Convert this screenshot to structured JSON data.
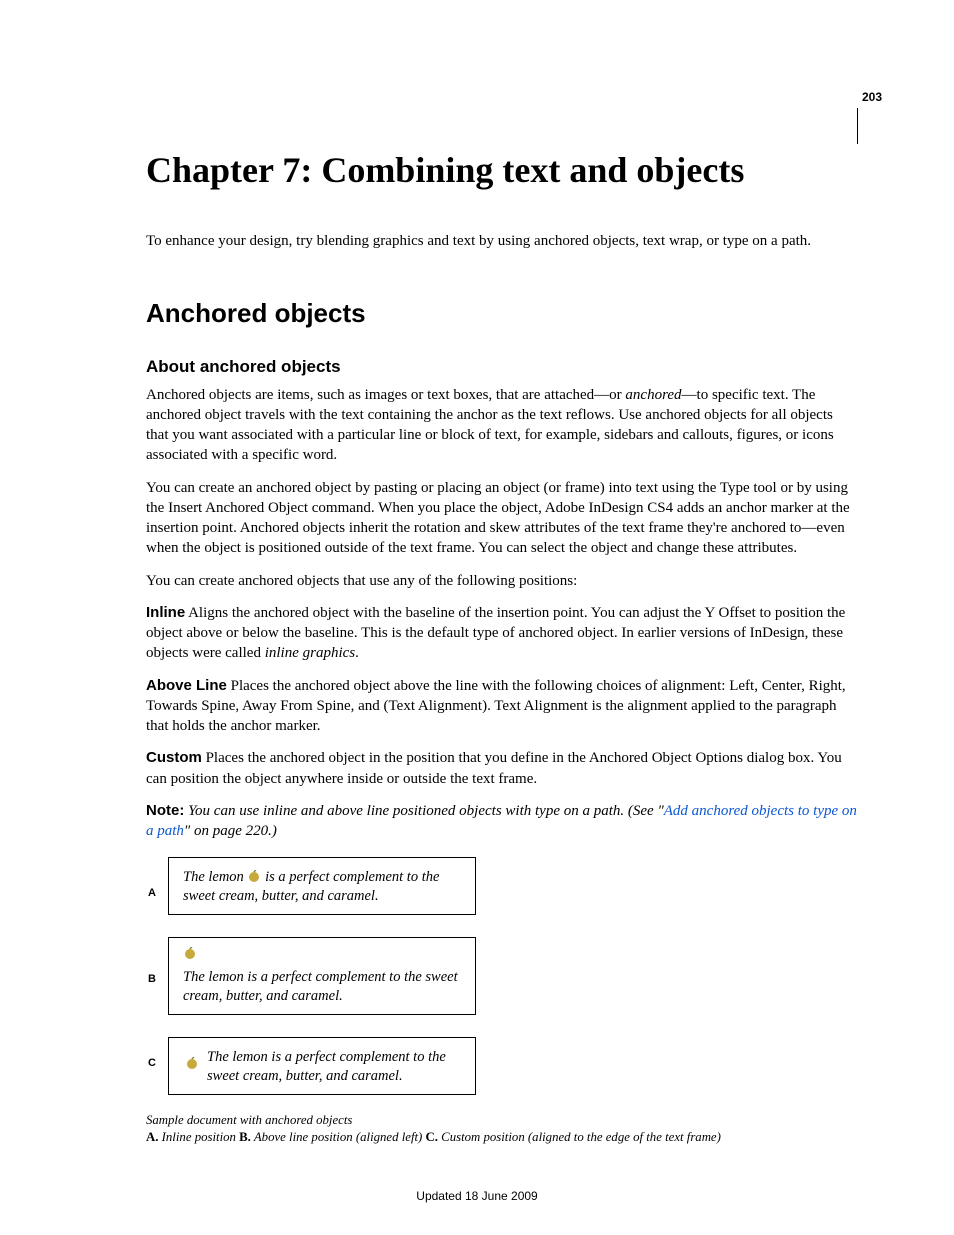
{
  "page_number": "203",
  "chapter_title": "Chapter 7: Combining text and objects",
  "intro": "To enhance your design, try blending graphics and text by using anchored objects, text wrap, or type on a path.",
  "section_title": "Anchored objects",
  "subsection_title": "About anchored objects",
  "para1_a": "Anchored objects are items, such as images or text boxes, that are attached—or ",
  "para1_em": "anchored",
  "para1_b": "—to specific text. The anchored object travels with the text containing the anchor as the text reflows. Use anchored objects for all objects that you want associated with a particular line or block of text, for example, sidebars and callouts, figures, or icons associated with a specific word.",
  "para2": "You can create an anchored object by pasting or placing an object (or frame) into text using the Type tool or by using the Insert Anchored Object command. When you place the object, Adobe InDesign CS4 adds an anchor marker at the insertion point. Anchored objects inherit the rotation and skew attributes of the text frame they're anchored to—even when the object is positioned outside of the text frame. You can select the object and change these attributes.",
  "para3": "You can create anchored objects that use any of the following positions:",
  "inline_label": "Inline",
  "inline_text_a": "  Aligns the anchored object with the baseline of the insertion point. You can adjust the Y Offset to position the object above or below the baseline. This is the default type of anchored object. In earlier versions of InDesign, these objects were called ",
  "inline_em": "inline graphics",
  "inline_text_b": ".",
  "above_label": "Above Line",
  "above_text": "  Places the anchored object above the line with the following choices of alignment: Left, Center, Right, Towards Spine, Away From Spine, and (Text Alignment). Text Alignment is the alignment applied to the paragraph that holds the anchor marker.",
  "custom_label": "Custom",
  "custom_text": "  Places the anchored object in the position that you define in the Anchored Object Options dialog box. You can position the object anywhere inside or outside the text frame.",
  "note_label": "Note:",
  "note_a": " You can use inline and above line positioned objects with type on a path. (See \"",
  "note_link": "Add anchored objects to type on a path",
  "note_b": "\" on page 220.)",
  "fig": {
    "label_a": "A",
    "label_b": "B",
    "label_c": "C",
    "text_a1": "The lemon ",
    "text_a2": " is a perfect complement to the sweet cream, butter, and caramel.",
    "text_b": "The lemon is a perfect complement to the sweet cream, butter, and caramel.",
    "text_c": "The lemon is a perfect complement to the sweet cream, butter, and caramel."
  },
  "caption": "Sample document with anchored objects",
  "legend": {
    "a_label": "A.",
    "a_text": " Inline position  ",
    "b_label": "B.",
    "b_text": " Above line position (aligned left)  ",
    "c_label": "C.",
    "c_text": " Custom position (aligned to the edge of the text frame)"
  },
  "footer": "Updated 18 June 2009"
}
